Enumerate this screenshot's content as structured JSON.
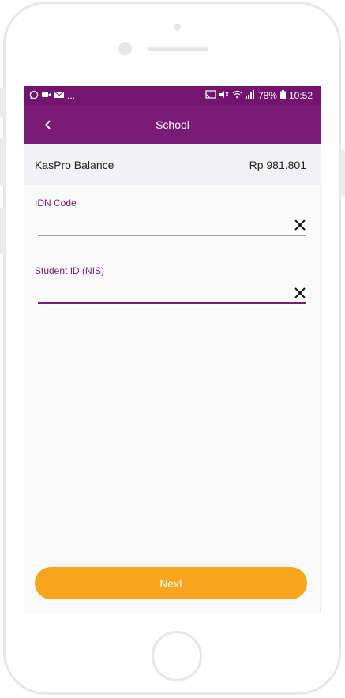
{
  "status_bar": {
    "left_icons": [
      "whatsapp-icon",
      "video-icon",
      "mail-icon"
    ],
    "overflow": "...",
    "battery": "78%",
    "time": "10:52"
  },
  "header": {
    "title": "School"
  },
  "balance": {
    "label": "KasPro Balance",
    "value": "Rp 981.801"
  },
  "fields": [
    {
      "label": "IDN Code",
      "value": ""
    },
    {
      "label": "Student ID (NIS)",
      "value": ""
    }
  ],
  "actions": {
    "next_label": "Next"
  },
  "colors": {
    "brand": "#7c1a78",
    "status_bar": "#73156f",
    "button": "#f9a61e"
  }
}
